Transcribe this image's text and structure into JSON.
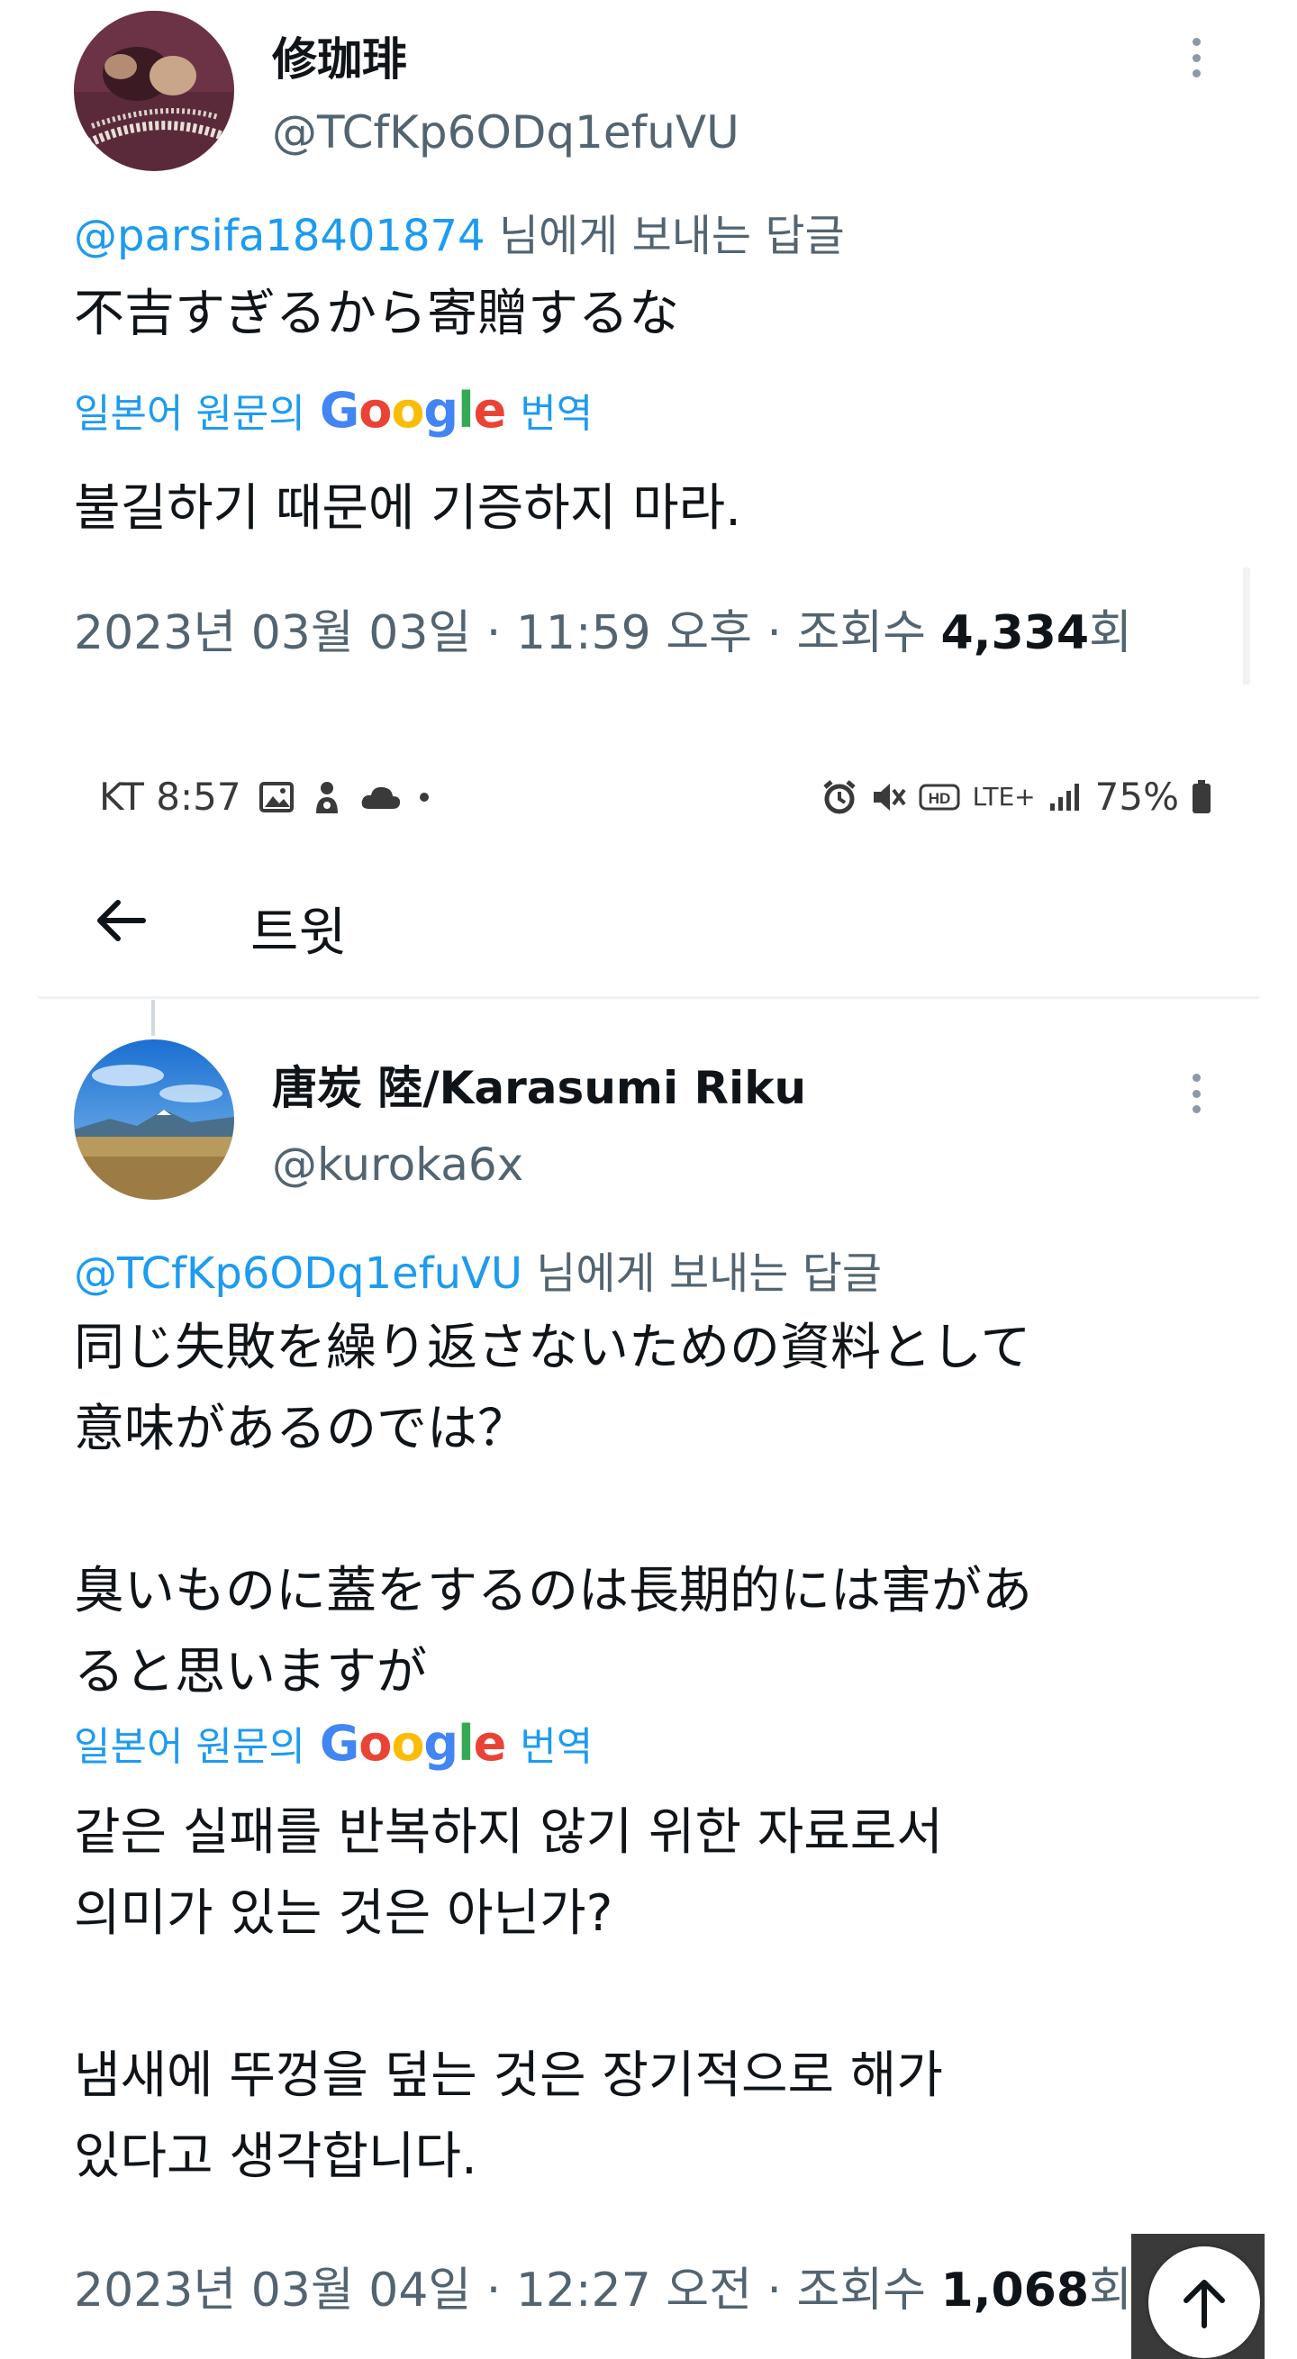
{
  "tweets": [
    {
      "display_name": "修珈琲",
      "handle": "@TCfKp6ODq1efuVU",
      "reply_mention": "@parsifa18401874",
      "reply_suffix": " 님에게 보내는 답글",
      "text": "不吉すぎるから寄贈するな",
      "translate_prefix": "일본어 원문의",
      "translate_suffix": "번역",
      "translated_text": "불길하기 때문에 기증하지 마라.",
      "timestamp": "2023년 03월 03일 · 11:59 오후 · 조회수 ",
      "views": "4,334",
      "views_suffix": "회"
    },
    {
      "display_name": "唐炭 陸/Karasumi Riku",
      "handle": "@kuroka6x",
      "reply_mention": "@TCfKp6ODq1efuVU",
      "reply_suffix": " 님에게 보내는 답글",
      "text": "同じ失敗を繰り返さないための資料として\n意味があるのでは？\n\n臭いものに蓋をするのは長期的には害があ\nると思いますが",
      "translate_prefix": "일본어 원문의",
      "translate_suffix": "번역",
      "translated_text": "같은 실패를 반복하지 않기 위한 자료로서\n의미가 있는 것은 아닌가?\n\n냄새에 뚜껑을 덮는 것은 장기적으로 해가\n있다고 생각합니다.",
      "timestamp": "2023년 03월 04일 · 12:27 오전 · 조회수 ",
      "views": "1,068",
      "views_suffix": "회"
    }
  ],
  "google_logo": [
    "G",
    "o",
    "o",
    "g",
    "l",
    "e"
  ],
  "status_bar": {
    "carrier_time": "KT 8:57",
    "network": "LTE+",
    "battery": "75%"
  },
  "header": {
    "title": "트윗"
  },
  "icons": {
    "more": "more-vertical-icon",
    "back": "arrow-left-icon",
    "scroll_top": "arrow-up-icon"
  },
  "colors": {
    "link": "#1d9bf0",
    "secondary_text": "#536471",
    "primary_text": "#0f1419"
  }
}
